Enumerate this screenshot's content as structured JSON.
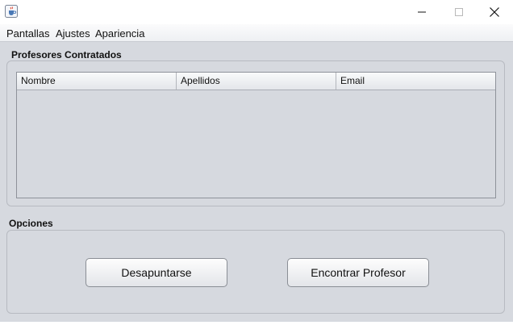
{
  "window": {
    "icon": "java-cup-icon",
    "controls": [
      "minimize-icon",
      "maximize-icon",
      "close-icon"
    ]
  },
  "menu": {
    "items": [
      {
        "label": "Pantallas"
      },
      {
        "label": "Ajustes"
      },
      {
        "label": "Apariencia"
      }
    ]
  },
  "contracted": {
    "title": "Profesores Contratados",
    "columns": [
      "Nombre",
      "Apellidos",
      "Email"
    ],
    "rows": []
  },
  "options": {
    "title": "Opciones",
    "unsubscribe_label": "Desapuntarse",
    "find_label": "Encontrar Profesor"
  },
  "colors": {
    "background": "#d6d9df",
    "border": "#b7bac1"
  }
}
